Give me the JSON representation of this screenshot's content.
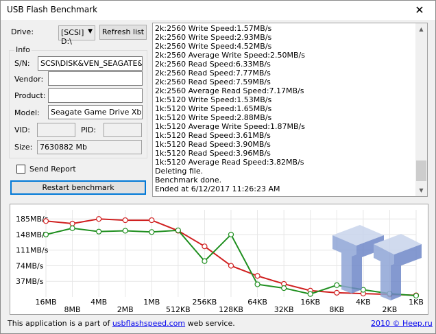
{
  "window": {
    "title": "USB Flash Benchmark",
    "close_glyph": "✕"
  },
  "drive": {
    "label": "Drive:",
    "selected": "[SCSI] D:\\",
    "refresh_label": "Refresh list"
  },
  "info": {
    "legend": "Info",
    "sn_label": "S/N:",
    "sn_value": "SCSI\\DISK&VEN_SEAGATE&PROD_GAME",
    "vendor_label": "Vendor:",
    "vendor_value": "",
    "product_label": "Product:",
    "product_value": "",
    "model_label": "Model:",
    "model_value": "Seagate Game Drive Xbox SSD",
    "vid_label": "VID:",
    "vid_value": "",
    "pid_label": "PID:",
    "pid_value": "",
    "size_label": "Size:",
    "size_value": "7630882 Mb"
  },
  "send_report": {
    "label": "Send Report",
    "checked": false
  },
  "restart_label": "Restart benchmark",
  "log": [
    "2k:2560 Write Speed:1.57MB/s",
    "2k:2560 Write Speed:2.93MB/s",
    "2k:2560 Write Speed:4.52MB/s",
    "2k:2560 Average Write Speed:2.50MB/s",
    "2k:2560 Read Speed:6.33MB/s",
    "2k:2560 Read Speed:7.77MB/s",
    "2k:2560 Read Speed:7.59MB/s",
    "2k:2560 Average Read Speed:7.17MB/s",
    "1k:5120 Write Speed:1.53MB/s",
    "1k:5120 Write Speed:1.65MB/s",
    "1k:5120 Write Speed:2.88MB/s",
    "1k:5120 Average Write Speed:1.87MB/s",
    "1k:5120 Read Speed:3.61MB/s",
    "1k:5120 Read Speed:3.90MB/s",
    "1k:5120 Read Speed:3.96MB/s",
    "1k:5120 Average Read Speed:3.82MB/s",
    "Deleting file.",
    "Benchmark done.",
    "Ended at 6/12/2017 11:26:23 AM"
  ],
  "chart_data": {
    "type": "line",
    "categories": [
      "16MB",
      "8MB",
      "4MB",
      "2MB",
      "1MB",
      "512KB",
      "256KB",
      "128KB",
      "64KB",
      "32KB",
      "16KB",
      "8KB",
      "4KB",
      "2KB",
      "1KB"
    ],
    "y_ticks": [
      "185MB/s",
      "148MB/s",
      "111MB/s",
      "74MB/s",
      "37MB/s"
    ],
    "ylim": [
      0,
      200
    ],
    "series": [
      {
        "color": "#d02020",
        "values": [
          180,
          174,
          185,
          182,
          182,
          157,
          120,
          74,
          50,
          31,
          15,
          10,
          8,
          6,
          4
        ]
      },
      {
        "color": "#1f8f1f",
        "values": [
          148,
          163,
          155,
          157,
          154,
          158,
          85,
          148,
          30,
          21,
          7,
          28,
          17,
          8,
          3
        ]
      }
    ]
  },
  "footer": {
    "left_prefix": "This application is a part of ",
    "left_link": "usbflashspeed.com",
    "left_suffix": " web service.",
    "right_link": "2010 © Heep.ru"
  }
}
